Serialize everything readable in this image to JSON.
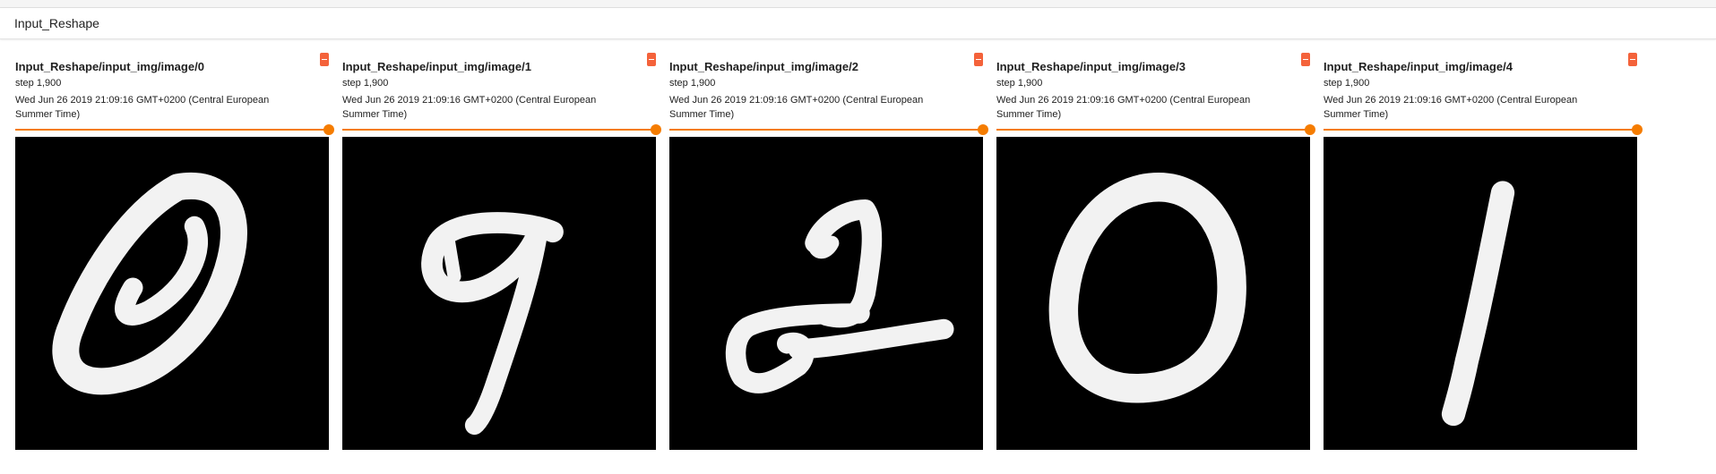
{
  "group": {
    "title": "Input_Reshape"
  },
  "cards": [
    {
      "title": "Input_Reshape/input_img/image/0",
      "step": "step 1,900",
      "time": "Wed Jun 26 2019 21:09:16 GMT+0200 (Central European Summer Time)",
      "digit": "0"
    },
    {
      "title": "Input_Reshape/input_img/image/1",
      "step": "step 1,900",
      "time": "Wed Jun 26 2019 21:09:16 GMT+0200 (Central European Summer Time)",
      "digit": "9"
    },
    {
      "title": "Input_Reshape/input_img/image/2",
      "step": "step 1,900",
      "time": "Wed Jun 26 2019 21:09:16 GMT+0200 (Central European Summer Time)",
      "digit": "2"
    },
    {
      "title": "Input_Reshape/input_img/image/3",
      "step": "step 1,900",
      "time": "Wed Jun 26 2019 21:09:16 GMT+0200 (Central European Summer Time)",
      "digit": "0"
    },
    {
      "title": "Input_Reshape/input_img/image/4",
      "step": "step 1,900",
      "time": "Wed Jun 26 2019 21:09:16 GMT+0200 (Central European Summer Time)",
      "digit": "1"
    }
  ],
  "colors": {
    "accent": "#f57c00",
    "expand_button": "#f4623a",
    "image_background": "#000000",
    "stroke": "#f2f2f2"
  },
  "icons": {
    "expand": "expand-icon"
  }
}
